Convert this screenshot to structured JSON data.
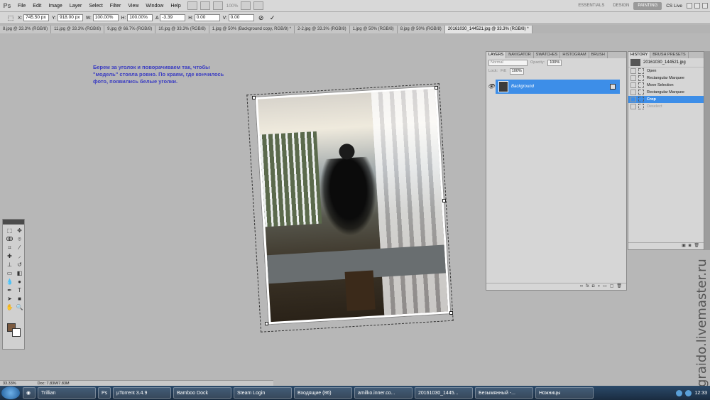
{
  "menubar": {
    "logo": "Ps",
    "items": [
      "File",
      "Edit",
      "Image",
      "Layer",
      "Select",
      "Filter",
      "View",
      "Window",
      "Help"
    ],
    "zoom": "100%",
    "workspaces": [
      "ESSENTIALS",
      "DESIGN",
      "PAINTING"
    ],
    "cslive": "CS Live"
  },
  "options": {
    "x_label": "X:",
    "x": "745.50 px",
    "y_label": "Y:",
    "y": "918.00 px",
    "w_label": "W:",
    "w": "100.00%",
    "h_label": "H:",
    "h": "100.00%",
    "angle_label": "∆",
    "angle": "-3.39",
    "hs_label": "H:",
    "hs": "0.00",
    "vs_label": "V:",
    "vs": "0.00",
    "cancel": "⊘",
    "commit": "✓"
  },
  "tabs": [
    "8.jpg @ 33.3% (RGB/8)",
    "11.jpg @ 33.3% (RGB/8)",
    "9.jpg @ 66.7% (RGB/8)",
    "10.jpg @ 33.3% (RGB/8)",
    "1.jpg @ 50% (Background copy, RGB/8) *",
    "2-2.jpg @ 33.3% (RGB/8)",
    "1.jpg @ 50% (RGB/8)",
    "8.jpg @ 50% (RGB/8)",
    "20161030_144521.jpg @ 33.3% (RGB/8) *"
  ],
  "note": "Берем за уголок и поворачиваем так, чтобы \"модель\" стояла ровно. По краям, где кончилось фото, появились белые уголки.",
  "layers": {
    "tabs": [
      "LAYERS",
      "NAVIGATOR",
      "SWATCHES",
      "HISTOGRAM",
      "BRUSH"
    ],
    "mode": "Normal",
    "opacity_label": "Opacity:",
    "opacity": "100%",
    "lock_label": "Lock:",
    "fill_label": "Fill:",
    "fill": "100%",
    "layer_name": "Background"
  },
  "history": {
    "tabs": [
      "HISTORY",
      "BRUSH PRESETS"
    ],
    "snapshot": "20161030_144521.jpg",
    "items": [
      "Open",
      "Rectangular Marquee",
      "Move Selection",
      "Rectangular Marquee",
      "Crop",
      "Deselect"
    ]
  },
  "status": {
    "zoom": "33.33%",
    "doc": "Doc: 7.83M/7.83M"
  },
  "taskbar": {
    "items": [
      "Trillian",
      "µTorrent 3.4.9",
      "Bamboo Dock",
      "Steam Login",
      "Входящие (86)",
      "amilko.inner.co...",
      "20161030_1445...",
      "Безымянный -...",
      "Ножницы"
    ],
    "time": "12:33"
  },
  "watermark": "graido.livemaster.ru"
}
